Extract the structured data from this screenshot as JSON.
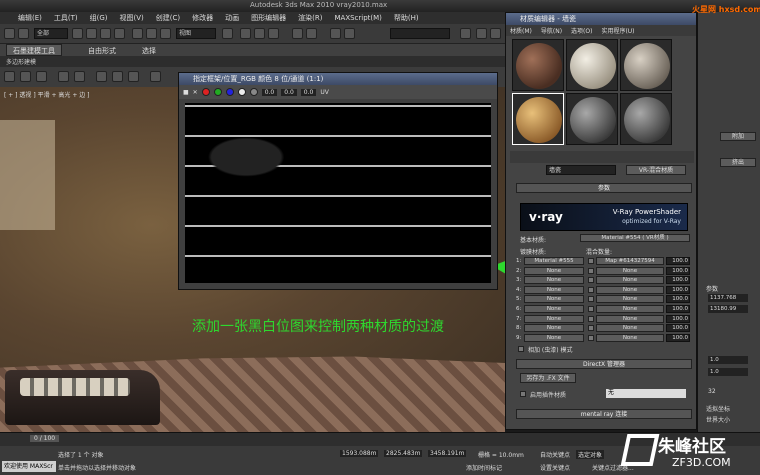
{
  "window": {
    "title": "Autodesk 3ds Max 2010  vray2010.max"
  },
  "menubar": [
    "编辑(E)",
    "工具(T)",
    "组(G)",
    "视图(V)",
    "创建(C)",
    "修改器",
    "动画",
    "图形编辑器",
    "渲染(R)",
    "MAXScript(M)",
    "帮助(H)"
  ],
  "toolbar": {
    "selection_filter": "全部",
    "view_dropdown": "视图"
  },
  "ribbon": {
    "tab_active": "石墨建模工具",
    "tab2": "自由形式",
    "tab3": "选择"
  },
  "polyrow": {
    "label": "多边形建模"
  },
  "viewport": {
    "label": "[ + ] 透视 ] 平滑 + 高光 + 边 ]"
  },
  "annotation": "添加一张黑白位图来控制两种材质的过渡",
  "bitmap_window": {
    "title": "指定框架/位置_RGB 颜色 8 位/通道 (1:1)",
    "field1": "0.0",
    "field2": "0.0",
    "field3": "0.0",
    "uv_label": "UV"
  },
  "material_editor": {
    "title": "材质编辑器 - 墙瓷",
    "menu": [
      "材质(M)",
      "导航(N)",
      "选项(O)",
      "实用程序(U)"
    ],
    "material_name": "墙瓷",
    "material_type": "VR-混合材质",
    "params_header": "参数",
    "vray_logo": "v·ray",
    "vray_title": "V-Ray PowerShader",
    "vray_subtitle": "optimized for V-Ray",
    "base_label": "基本材质:",
    "base_value": "Material #554 ( VR材质 )",
    "coat_label": "镀膜材质:",
    "blend_label": "混合数量:",
    "rows": [
      {
        "num": "1:",
        "slot": "Material #555",
        "map": "Map #614327594",
        "val": "100.0"
      },
      {
        "num": "2:",
        "slot": "None",
        "map": "None",
        "val": "100.0"
      },
      {
        "num": "3:",
        "slot": "None",
        "map": "None",
        "val": "100.0"
      },
      {
        "num": "4:",
        "slot": "None",
        "map": "None",
        "val": "100.0"
      },
      {
        "num": "5:",
        "slot": "None",
        "map": "None",
        "val": "100.0"
      },
      {
        "num": "6:",
        "slot": "None",
        "map": "None",
        "val": "100.0"
      },
      {
        "num": "7:",
        "slot": "None",
        "map": "None",
        "val": "100.0"
      },
      {
        "num": "8:",
        "slot": "None",
        "map": "None",
        "val": "100.0"
      },
      {
        "num": "9:",
        "slot": "None",
        "map": "None",
        "val": "100.0"
      }
    ],
    "additive_label": "相加 (虫漆) 模式",
    "directx_header": "DirectX 管理器",
    "save_fx_button": "另存为 .FX 文件",
    "plugin_label": "启用插件材质",
    "plugin_value": "无",
    "mental_header": "mental ray 连接"
  },
  "cmd_panel": {
    "buttons": [
      "附加",
      "挤出"
    ],
    "values": [
      "1137.768",
      "13180.99",
      "1.0",
      "1.0",
      "32"
    ],
    "labels": [
      "参数",
      "适拟坐标",
      "世界大小"
    ]
  },
  "timeline": {
    "frame": "0 / 100"
  },
  "status": {
    "line1": "选择了 1 个 对象",
    "line2": "单击并拖动以选择并移动对象",
    "maxscript": "欢迎使用 MAXScr",
    "x": "1593.088m",
    "y": "2825.483m",
    "z": "3458.191m",
    "grid": "栅格 = 10.0mm",
    "autokey": "自动关键点",
    "setkey": "设置关键点",
    "selected": "选定对象",
    "addtime": "添加时间标记",
    "keyfilter": "关键点过滤器..."
  },
  "watermarks": {
    "top": "火星网 hxsd.com",
    "bottom_big": "朱峰社区",
    "bottom_small": "ZF3D.COM"
  },
  "colors": {
    "annotation": "#2ed82e",
    "titlebar_blue": "#4a5a7a"
  }
}
